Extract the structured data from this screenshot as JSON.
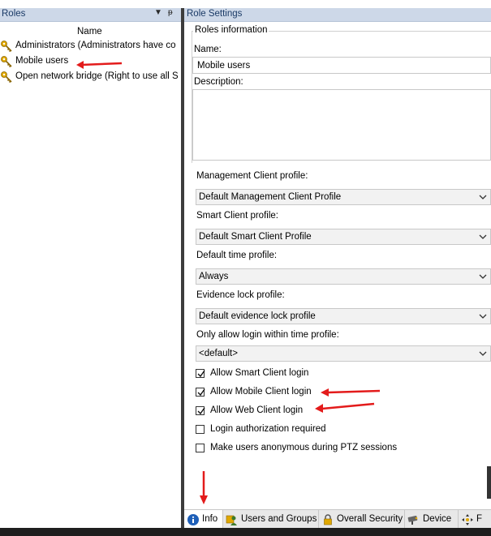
{
  "left_panel": {
    "title": "Roles",
    "dropdown_glyph": "▼",
    "pin_glyph": "ᵽ",
    "column_header": "Name",
    "roles": [
      {
        "label": "Administrators (Administrators have co",
        "icon": "key-icon"
      },
      {
        "label": "Mobile users",
        "icon": "key-icon"
      },
      {
        "label": "Open network bridge (Right to use all S",
        "icon": "key-icon"
      }
    ]
  },
  "right_panel": {
    "title": "Role Settings",
    "group_title": "Roles information",
    "name_label": "Name:",
    "name_value": "Mobile users",
    "description_label": "Description:",
    "description_value": "",
    "fields": {
      "mgmt_label": "Management Client profile:",
      "mgmt_value": "Default Management Client Profile",
      "smart_label": "Smart Client profile:",
      "smart_value": "Default Smart Client Profile",
      "time_label": "Default time profile:",
      "time_value": "Always",
      "evidence_label": "Evidence lock profile:",
      "evidence_value": "Default evidence lock profile",
      "login_time_label": "Only allow login within time profile:",
      "login_time_value": "<default>"
    },
    "checkboxes": [
      {
        "label": "Allow Smart Client login",
        "checked": true
      },
      {
        "label": "Allow Mobile Client login",
        "checked": true
      },
      {
        "label": "Allow Web Client login",
        "checked": true
      },
      {
        "label": "Login authorization required",
        "checked": false
      },
      {
        "label": "Make users anonymous during PTZ sessions",
        "checked": false
      }
    ],
    "tabs": [
      {
        "label": "Info",
        "icon": "info-icon",
        "active": true
      },
      {
        "label": "Users and Groups",
        "icon": "users-icon",
        "active": false
      },
      {
        "label": "Overall Security",
        "icon": "lock-icon",
        "active": false
      },
      {
        "label": "Device",
        "icon": "camera-icon",
        "active": false
      },
      {
        "label": "F",
        "icon": "ptz-icon",
        "active": false
      }
    ]
  },
  "colors": {
    "header_bg": "#cdd8e8",
    "annotation_arrow": "#e31b1b",
    "key_icon": "#e0a800"
  }
}
